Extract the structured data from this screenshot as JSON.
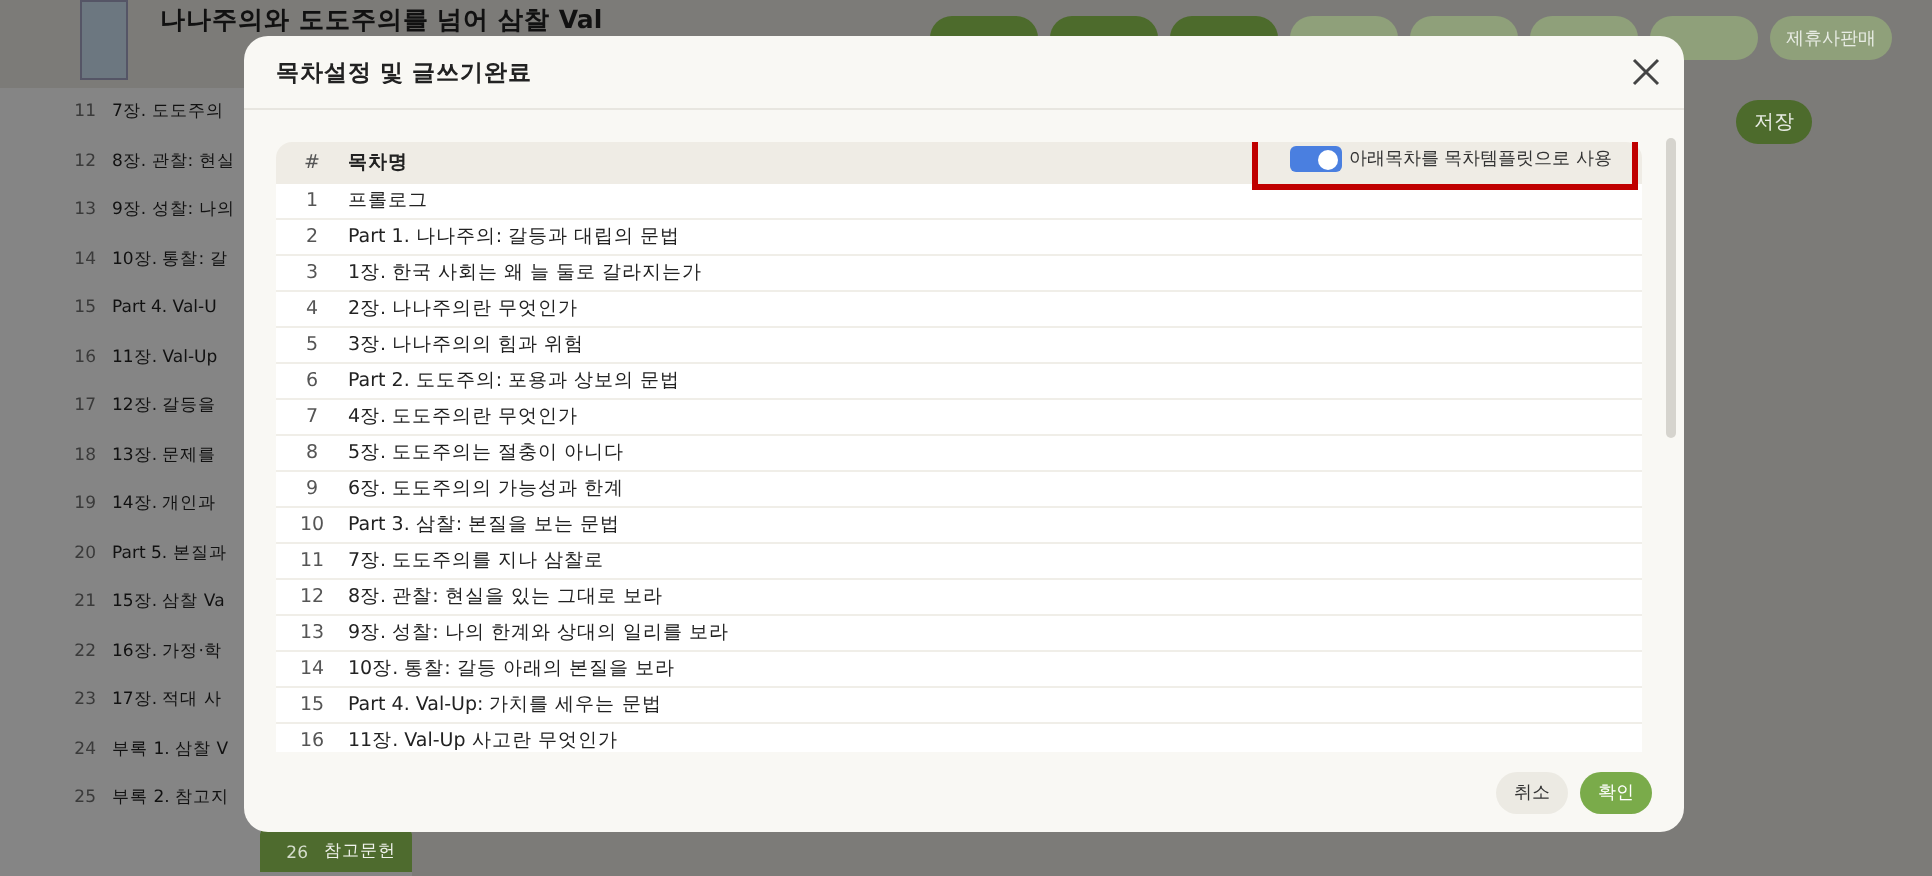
{
  "header": {
    "title": "나나주의와 도도주의를 넘어 삼찰 Val",
    "buttons": [
      {
        "color": "#4d6b2c"
      },
      {
        "color": "#4d6b2c"
      },
      {
        "color": "#4d6b2c"
      },
      {
        "color": "#8fa07a"
      },
      {
        "color": "#8fa07a"
      },
      {
        "color": "#8fa07a"
      },
      {
        "color": "#8fa07a"
      },
      {
        "label": "제휴사판매",
        "color": "#8fa07a"
      }
    ]
  },
  "sidebar": {
    "items": [
      {
        "number": "11",
        "title": "7장. 도도주의",
        "selected": false
      },
      {
        "number": "12",
        "title": "8장. 관찰: 현실",
        "selected": false
      },
      {
        "number": "13",
        "title": "9장. 성찰: 나의",
        "selected": false
      },
      {
        "number": "14",
        "title": "10장. 통찰: 갈",
        "selected": false
      },
      {
        "number": "15",
        "title": "Part 4. Val-U",
        "selected": false
      },
      {
        "number": "16",
        "title": "11장. Val-Up",
        "selected": false
      },
      {
        "number": "17",
        "title": "12장. 갈등을",
        "selected": false
      },
      {
        "number": "18",
        "title": "13장. 문제를",
        "selected": false
      },
      {
        "number": "19",
        "title": "14장. 개인과",
        "selected": false
      },
      {
        "number": "20",
        "title": "Part 5. 본질과",
        "selected": false
      },
      {
        "number": "21",
        "title": "15장. 삼찰 Va",
        "selected": false
      },
      {
        "number": "22",
        "title": "16장. 가정·학",
        "selected": false
      },
      {
        "number": "23",
        "title": "17장. 적대 사",
        "selected": false
      },
      {
        "number": "24",
        "title": "부록 1. 삼찰 V",
        "selected": false
      },
      {
        "number": "25",
        "title": "부록 2. 참고지",
        "selected": false
      },
      {
        "number": "26",
        "title": "참고문헌",
        "selected": true
      }
    ]
  },
  "editor": {
    "save_button": "저장"
  },
  "dialog": {
    "title": "목차설정 및 글쓰기완료",
    "template_toggle": {
      "label": "아래목차를 목차템플릿으로 사용",
      "on": true,
      "highlighted": true
    },
    "table": {
      "columns": [
        "#",
        "목차명"
      ],
      "rows": [
        {
          "number": "1",
          "title": "프롤로그"
        },
        {
          "number": "2",
          "title": "Part 1. 나나주의: 갈등과 대립의 문법"
        },
        {
          "number": "3",
          "title": "1장. 한국 사회는 왜 늘 둘로 갈라지는가"
        },
        {
          "number": "4",
          "title": "2장. 나나주의란 무엇인가"
        },
        {
          "number": "5",
          "title": "3장. 나나주의의 힘과 위험"
        },
        {
          "number": "6",
          "title": "Part 2. 도도주의: 포용과 상보의 문법"
        },
        {
          "number": "7",
          "title": "4장. 도도주의란 무엇인가"
        },
        {
          "number": "8",
          "title": "5장. 도도주의는 절충이 아니다"
        },
        {
          "number": "9",
          "title": "6장. 도도주의의 가능성과 한계"
        },
        {
          "number": "10",
          "title": "Part 3. 삼찰: 본질을 보는 문법"
        },
        {
          "number": "11",
          "title": "7장. 도도주의를 지나 삼찰로"
        },
        {
          "number": "12",
          "title": "8장. 관찰: 현실을 있는 그대로 보라"
        },
        {
          "number": "13",
          "title": "9장. 성찰: 나의 한계와 상대의 일리를 보라"
        },
        {
          "number": "14",
          "title": "10장. 통찰: 갈등 아래의 본질을 보라"
        },
        {
          "number": "15",
          "title": "Part 4. Val-Up: 가치를 세우는 문법"
        },
        {
          "number": "16",
          "title": "11장. Val-Up 사고란 무엇인가"
        }
      ]
    },
    "buttons": [
      {
        "label": "취소",
        "kind": "cancel"
      },
      {
        "label": "확인",
        "kind": "confirm"
      }
    ]
  }
}
